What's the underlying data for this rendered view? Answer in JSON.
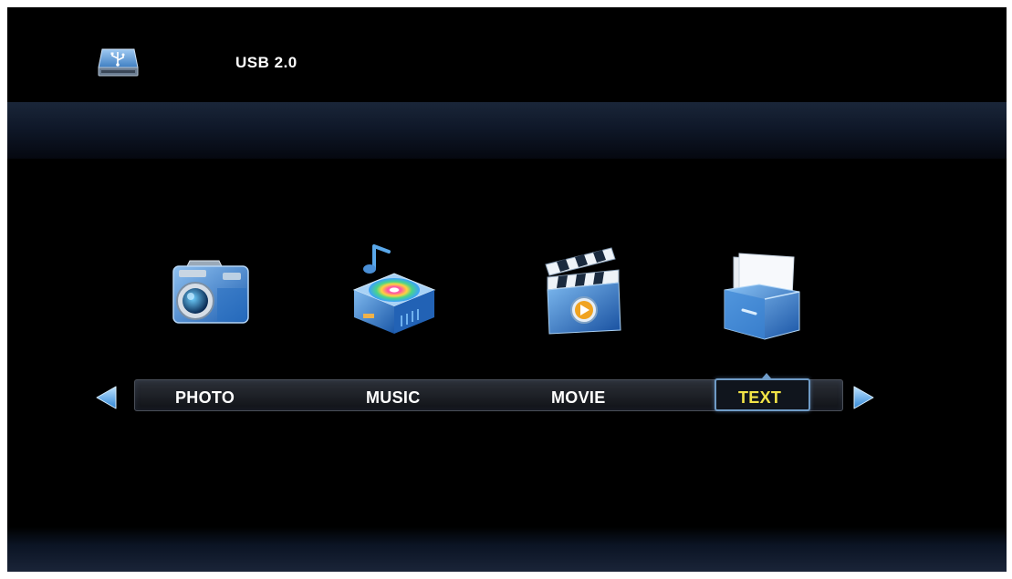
{
  "header": {
    "device_icon": "usb-drive-icon",
    "device_label": "USB 2.0"
  },
  "menu": {
    "items": [
      {
        "label": "PHOTO",
        "icon": "camera-icon"
      },
      {
        "label": "MUSIC",
        "icon": "music-disc-icon"
      },
      {
        "label": "MOVIE",
        "icon": "clapperboard-icon"
      },
      {
        "label": "TEXT",
        "icon": "folder-document-icon"
      }
    ],
    "selected": "TEXT",
    "left_arrow_icon": "arrow-left-icon",
    "right_arrow_icon": "arrow-right-icon"
  },
  "colors": {
    "background": "#000000",
    "selected_text": "#f2e447",
    "selection_border": "#6f9bc6",
    "icon_blue": "#2d7fd6"
  }
}
